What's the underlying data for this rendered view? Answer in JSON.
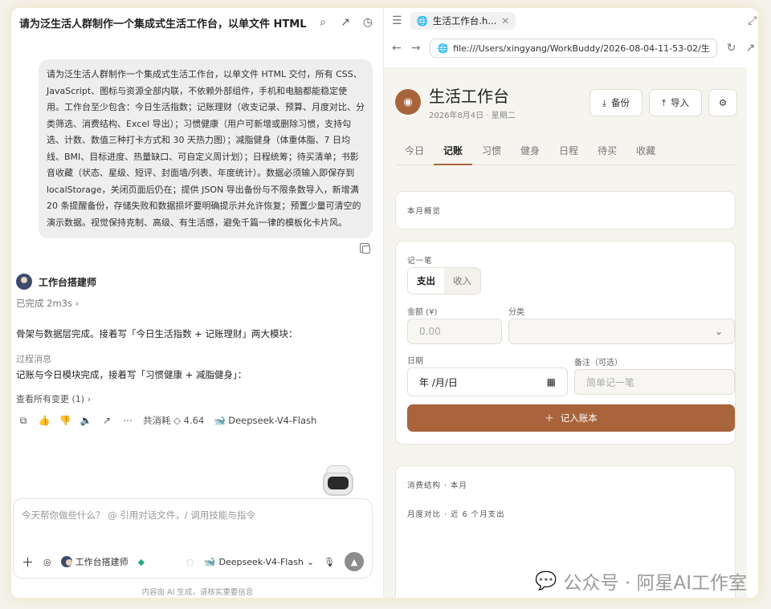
{
  "chat": {
    "title": "请为泛生活人群制作一个集成式生活工作台，以单文件 HTML 交付",
    "prompt": "请为泛生活人群制作一个集成式生活工作台，以单文件 HTML 交付，所有 CSS、JavaScript、图标与资源全部内联，不依赖外部组件，手机和电脑都能稳定使用。工作台至少包含：今日生活指数；记账理财（收支记录、预算、月度对比、分类筛选、消费结构、Excel 导出）；习惯健康（用户可新增或删除习惯，支持勾选、计数、数值三种打卡方式和 30 天热力图）；减脂健身（体重体脂、7 日均线、BMI、目标进度、热量缺口、可自定义周计划）；日程统筹；待买清单；书影音收藏（状态、星级、短评、封面墙/列表、年度统计）。数据必须输入即保存到 localStorage，关闭页面后仍在；提供 JSON 导出备份与不限条数导入，新增满 20 条提醒备份，存储失败和数据损坏要明确提示并允许恢复；预置少量可清空的演示数据。视觉保持克制、高级、有生活感，避免千篇一律的模板化卡片风。",
    "agent_name": "工作台搭建师",
    "done_text": "已完成 2m3s",
    "message1": "骨架与数据层完成。接着写「今日生活指数 + 记账理财」两大模块：",
    "process_label": "过程消息",
    "message2": "记账与今日模块完成，接着写「习惯健康 + 减脂健身」：",
    "changes_link": "查看所有变更 (1)",
    "cost": "共消耗 ◇ 4.64",
    "model": "Deepseek-V4-Flash",
    "input_placeholder": "今天帮你做些什么？ @ 引用对话文件，/ 调用技能与指令",
    "tool_agent": "工作台搭建师",
    "tool_model": "Deepseek-V4-Flash",
    "footer": "内容由 AI 生成，请核实重要信息"
  },
  "browser": {
    "tab_title": "生活工作台.h...",
    "url": "file:///Users/xingyang/WorkBuddy/2026-08-04-11-53-02/生"
  },
  "app": {
    "title": "生活工作台",
    "date": "2026年8月4日 · 星期二",
    "backup_label": "备份",
    "import_label": "导入",
    "tabs": [
      "今日",
      "记账",
      "习惯",
      "健身",
      "日程",
      "待买",
      "收藏"
    ],
    "overview_label": "本月概览",
    "record_label": "记一笔",
    "type_expense": "支出",
    "type_income": "收入",
    "amount_label": "金额 (¥)",
    "amount_placeholder": "0.00",
    "category_label": "分类",
    "date_label": "日期",
    "date_value": "年 /月/日",
    "note_label": "备注（可选）",
    "note_placeholder": "简单记一笔",
    "submit_label": "记入账本",
    "structure_label": "消费结构 · 本月",
    "compare_label": "月度对比 · 近 6 个月支出"
  },
  "watermark": "公众号 · 阿星AI工作室",
  "colors": {
    "accent": "#a9643c",
    "page_bg": "#f6f4ef"
  }
}
